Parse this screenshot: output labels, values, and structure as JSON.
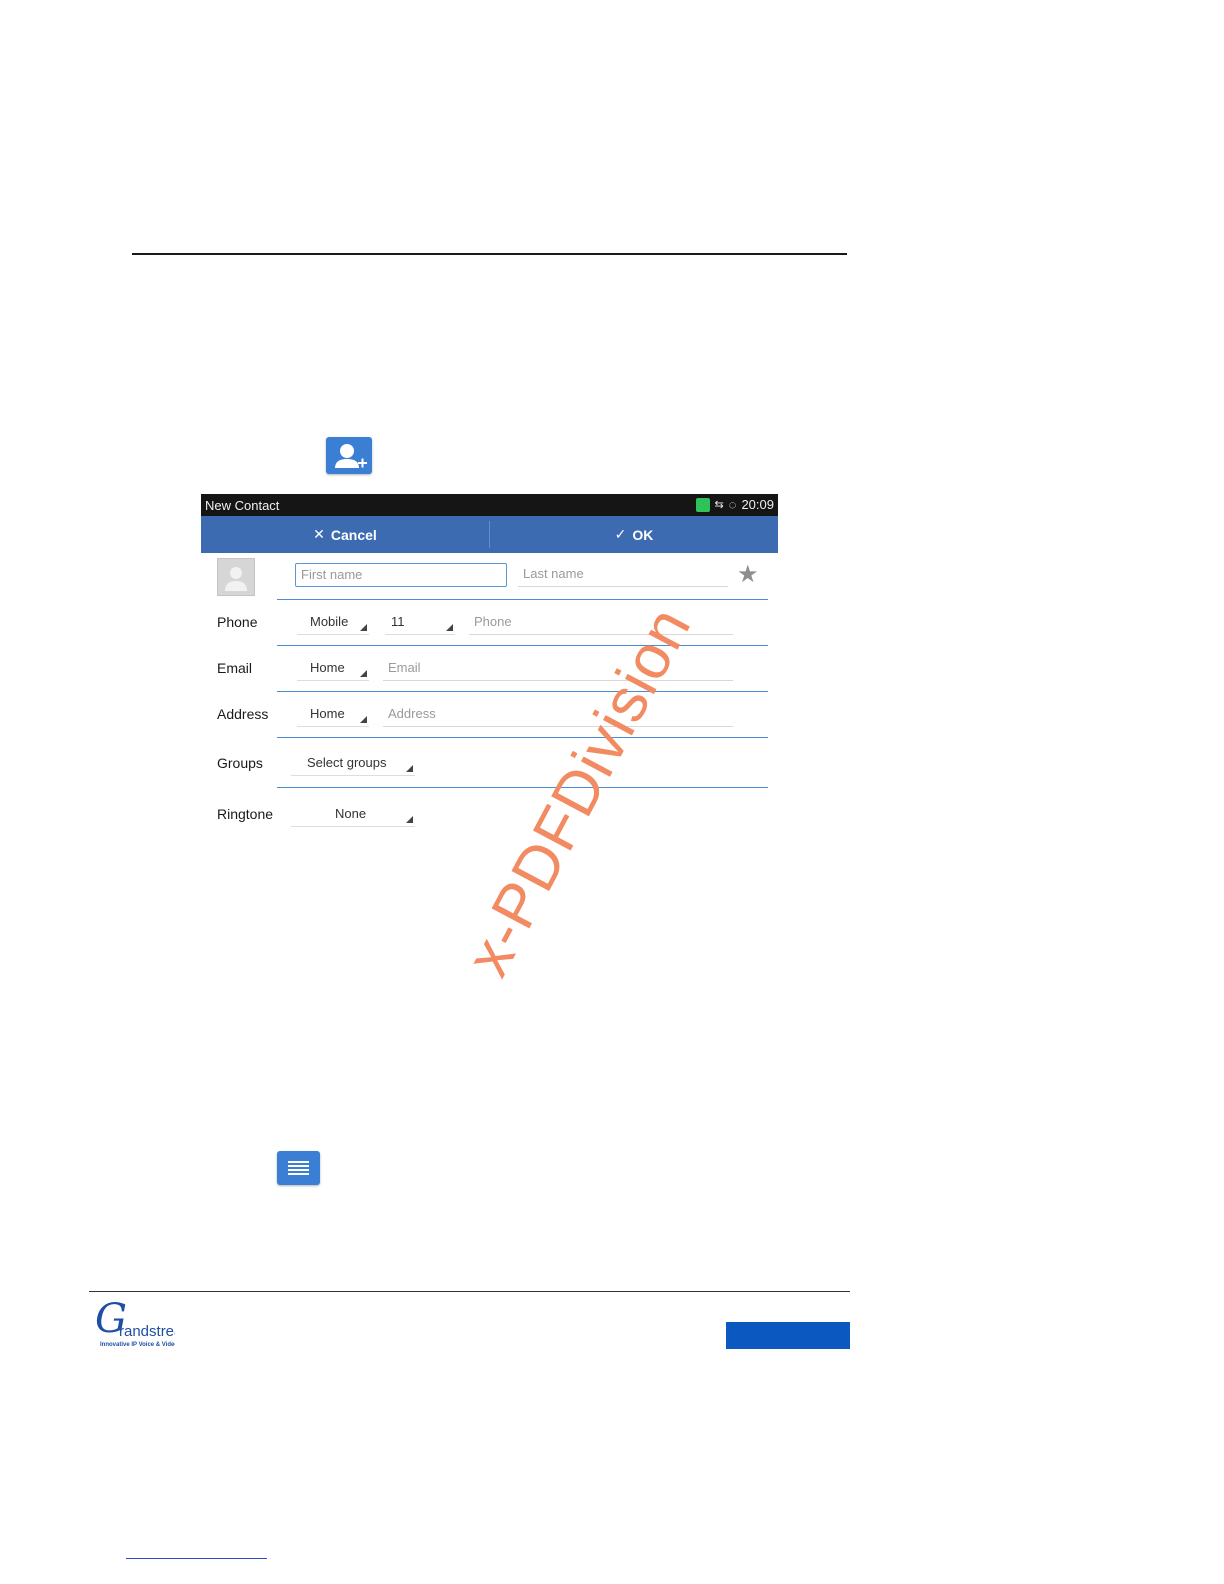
{
  "screen": {
    "status": {
      "title": "New Contact",
      "time": "20:09"
    },
    "actions": {
      "cancel": "Cancel",
      "ok": "OK"
    },
    "name": {
      "first_placeholder": "First name",
      "last_placeholder": "Last name"
    },
    "rows": {
      "phone": {
        "label": "Phone",
        "type": "Mobile",
        "code": "11",
        "placeholder": "Phone"
      },
      "email": {
        "label": "Email",
        "type": "Home",
        "placeholder": "Email"
      },
      "address": {
        "label": "Address",
        "type": "Home",
        "placeholder": "Address"
      },
      "groups": {
        "label": "Groups",
        "value": "Select groups"
      },
      "ringtone": {
        "label": "Ringtone",
        "value": "None"
      }
    }
  },
  "watermark": "x-PDFDivision",
  "logo": {
    "brand": "Grandstream",
    "tagline": "Innovative IP Voice & Video"
  },
  "colors": {
    "accent": "#3b7fd4",
    "actionbar": "#3c6bb1",
    "footer_bar": "#0b58c0",
    "watermark": "#f28a62"
  }
}
